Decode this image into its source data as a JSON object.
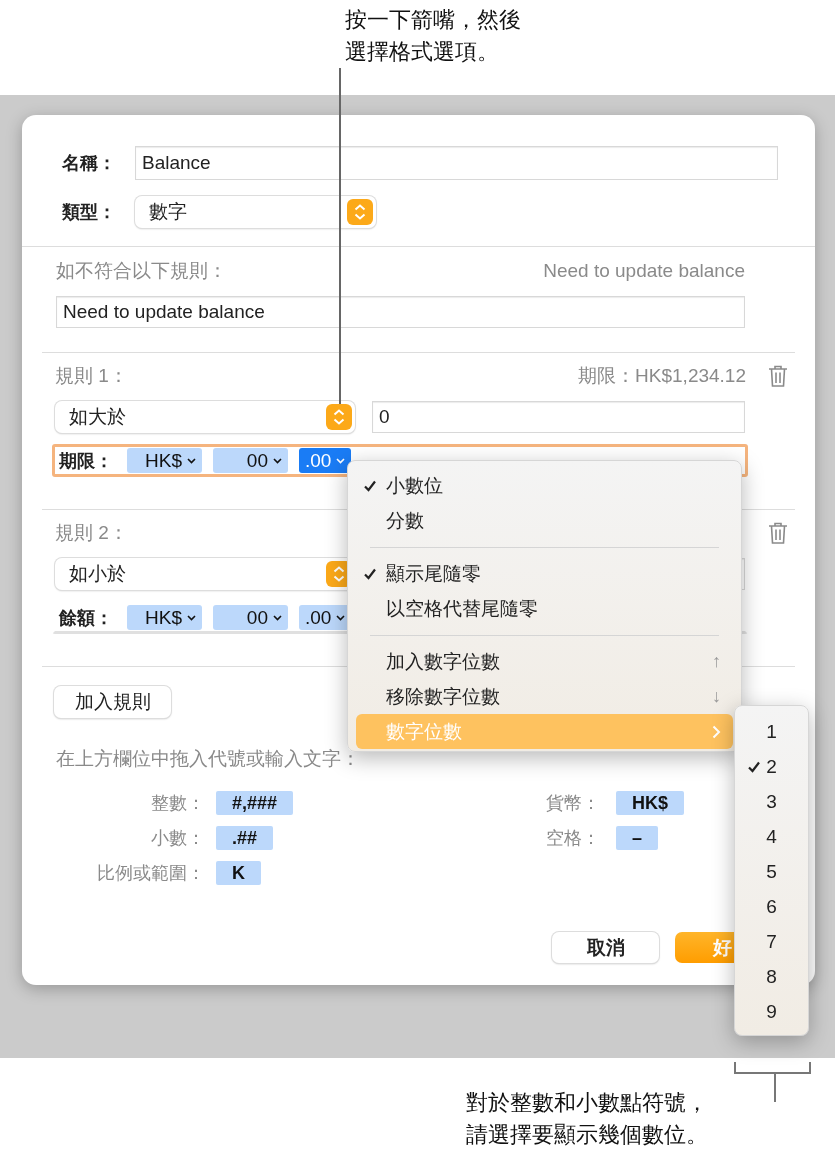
{
  "callout_top": {
    "lines": [
      "按一下箭嘴，然後",
      "選擇格式選項。"
    ]
  },
  "dialog": {
    "name_label": "名稱：",
    "name_value": "Balance",
    "type_label": "類型：",
    "type_value": "數字",
    "fallback_label": "如不符合以下規則：",
    "fallback_preview": "Need to update balance",
    "fallback_value": "Need to update balance",
    "rules": [
      {
        "label": "規則 1：",
        "preview": "期限：HK$1,234.12",
        "condition": "如大於",
        "value": "0",
        "focused": true,
        "format_label": "期限：",
        "tokens": [
          {
            "text": "HK$",
            "selected": false
          },
          {
            "text": "00",
            "selected": false
          },
          {
            "text": ".00",
            "selected": true
          }
        ]
      },
      {
        "label": "規則 2：",
        "condition": "如小於",
        "focused": false,
        "format_label": "餘額：",
        "tokens": [
          {
            "text": "HK$",
            "selected": false
          },
          {
            "text": "00",
            "selected": false
          },
          {
            "text": ".00",
            "selected": false
          }
        ]
      }
    ],
    "add_rule_button": "加入規則",
    "hint": "在上方欄位中拖入代號或輸入文字：",
    "tokens_left": [
      {
        "label": "整數：",
        "token": "#,###"
      },
      {
        "label": "小數：",
        "token": ".##"
      },
      {
        "label": "比例或範圍：",
        "token": "K"
      }
    ],
    "tokens_right": [
      {
        "label": "貨幣：",
        "token": "HK$"
      },
      {
        "label": "空格：",
        "token": "–"
      }
    ],
    "buttons": [
      {
        "label": "取消",
        "kind": "cancel"
      },
      {
        "label": "好",
        "kind": "default"
      }
    ]
  },
  "format_menu": {
    "items": [
      {
        "kind": "item",
        "label": "小數位",
        "checked": true,
        "selected": false
      },
      {
        "kind": "item",
        "label": "分數",
        "checked": false,
        "selected": false
      },
      {
        "kind": "separator"
      },
      {
        "kind": "item",
        "label": "顯示尾隨零",
        "checked": true,
        "selected": false
      },
      {
        "kind": "item",
        "label": "以空格代替尾隨零",
        "checked": false,
        "selected": false
      },
      {
        "kind": "separator"
      },
      {
        "kind": "item",
        "label": "加入數字位數",
        "checked": false,
        "selected": false,
        "shortcut": "↑"
      },
      {
        "kind": "item",
        "label": "移除數字位數",
        "checked": false,
        "selected": false,
        "shortcut": "↓"
      },
      {
        "kind": "submenu",
        "label": "數字位數",
        "checked": false,
        "selected": true
      }
    ]
  },
  "digits_menu": {
    "items": [
      {
        "label": "1",
        "checked": false
      },
      {
        "label": "2",
        "checked": true
      },
      {
        "label": "3",
        "checked": false
      },
      {
        "label": "4",
        "checked": false
      },
      {
        "label": "5",
        "checked": false
      },
      {
        "label": "6",
        "checked": false
      },
      {
        "label": "7",
        "checked": false
      },
      {
        "label": "8",
        "checked": false
      },
      {
        "label": "9",
        "checked": false
      }
    ]
  },
  "callout_bottom": {
    "lines": [
      "對於整數和小數點符號，",
      "請選擇要顯示幾個數位。"
    ]
  }
}
